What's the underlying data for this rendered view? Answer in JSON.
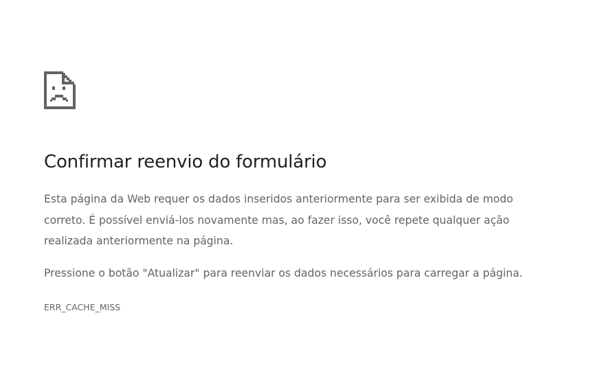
{
  "icon": {
    "name": "sad-page-icon",
    "color": "#5f6368"
  },
  "heading": "Confirmar reenvio do formulário",
  "description": "Esta página da Web requer os dados inseridos anteriormente para ser exibida de modo correto. É possível enviá-los novamente mas, ao fazer isso, você repete qualquer ação realizada anteriormente na página.",
  "instruction": "Pressione o botão \"Atualizar\" para reenviar os dados necessários para carregar a página.",
  "error_code": "ERR_CACHE_MISS",
  "colors": {
    "heading": "#202124",
    "body_text": "#5f6368",
    "background": "#ffffff"
  }
}
